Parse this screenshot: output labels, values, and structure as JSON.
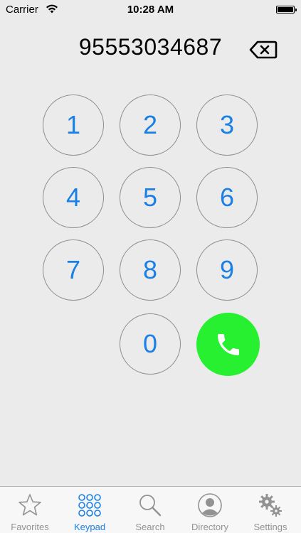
{
  "status_bar": {
    "carrier": "Carrier",
    "time": "10:28 AM"
  },
  "dialer": {
    "number": "95553034687",
    "backspace_icon": "backspace-icon"
  },
  "keypad": {
    "keys": [
      "1",
      "2",
      "3",
      "4",
      "5",
      "6",
      "7",
      "8",
      "9",
      "0"
    ],
    "call_icon": "phone-icon"
  },
  "tab_bar": {
    "active_tab": "Keypad",
    "tabs": [
      {
        "label": "Favorites",
        "icon": "star-icon"
      },
      {
        "label": "Keypad",
        "icon": "keypad-grid-icon"
      },
      {
        "label": "Search",
        "icon": "search-icon"
      },
      {
        "label": "Directory",
        "icon": "person-icon"
      },
      {
        "label": "Settings",
        "icon": "gear-icon"
      }
    ]
  },
  "colors": {
    "accent": "#1a80e6",
    "call_green": "#27f031",
    "background": "#ebebeb",
    "inactive_tab": "#929292"
  }
}
